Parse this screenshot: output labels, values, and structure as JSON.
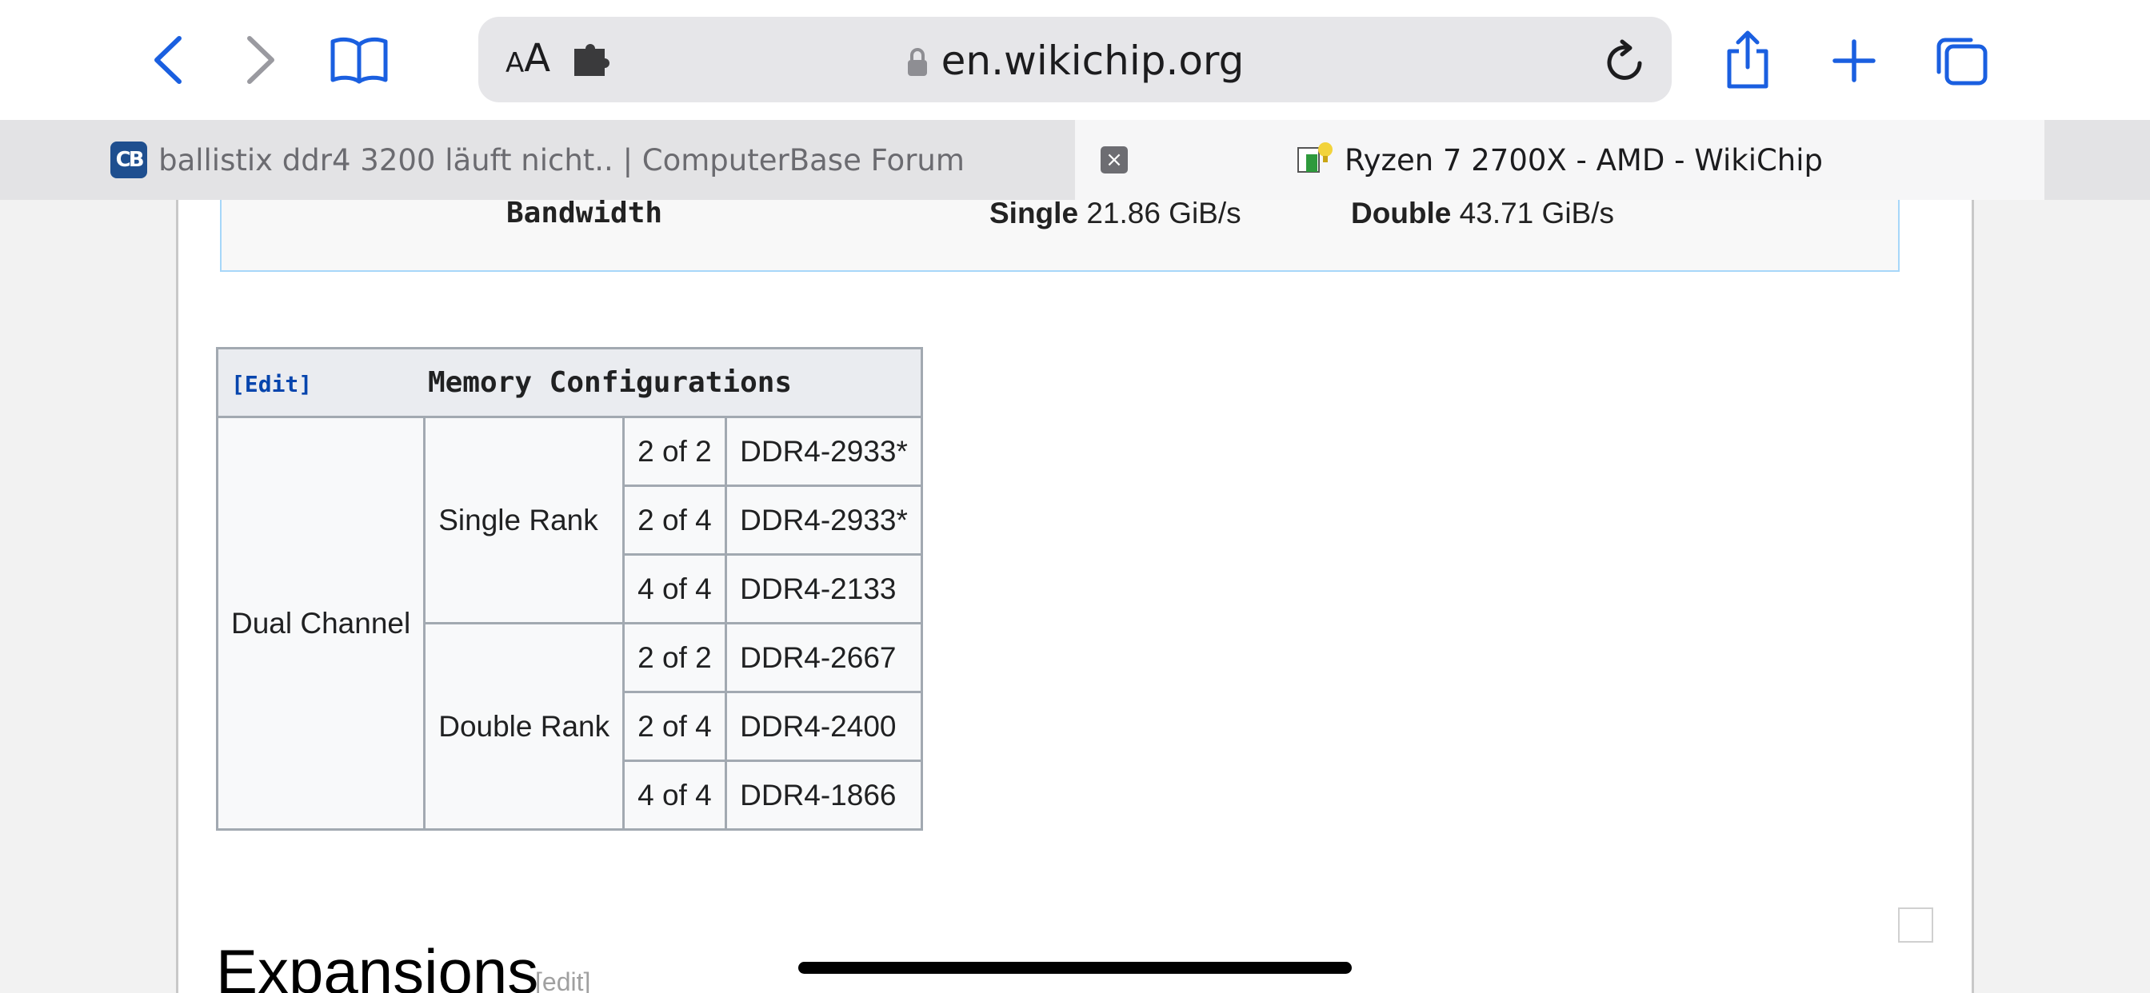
{
  "browser": {
    "reader_label_small": "A",
    "reader_label_big": "A",
    "url": "en.wikichip.org",
    "icons": {
      "back": "chevron-left-icon",
      "forward": "chevron-right-icon",
      "bookmarks": "book-icon",
      "extension": "puzzle-icon",
      "lock": "lock-icon",
      "reload": "reload-icon",
      "share": "share-icon",
      "new_tab": "plus-icon",
      "tabs": "tabs-overview-icon"
    },
    "accent_color": "#1a5fe0"
  },
  "tabs": [
    {
      "favicon": "CB",
      "title": "ballistix ddr4 3200 läuft nicht.. | ComputerBase Forum",
      "active": false
    },
    {
      "close": "×",
      "title": "Ryzen 7 2700X - AMD - WikiChip",
      "active": true
    }
  ],
  "bandwidth": {
    "label": "Bandwidth",
    "single_label": "Single",
    "single_value": "21.86 GiB/s",
    "double_label": "Double",
    "double_value": "43.71 GiB/s"
  },
  "memory_table": {
    "edit": "[Edit]",
    "title": "Memory Configurations",
    "channel": "Dual Channel",
    "groups": [
      {
        "rank": "Single Rank",
        "rows": [
          {
            "slots": "2 of 2",
            "speed": "DDR4-2933*"
          },
          {
            "slots": "2 of 4",
            "speed": "DDR4-2933*"
          },
          {
            "slots": "4 of 4",
            "speed": "DDR4-2133"
          }
        ]
      },
      {
        "rank": "Double Rank",
        "rows": [
          {
            "slots": "2 of 2",
            "speed": "DDR4-2667"
          },
          {
            "slots": "2 of 4",
            "speed": "DDR4-2400"
          },
          {
            "slots": "4 of 4",
            "speed": "DDR4-1866"
          }
        ]
      }
    ]
  },
  "section": {
    "heading": "Expansions",
    "edit": "[edit]"
  }
}
